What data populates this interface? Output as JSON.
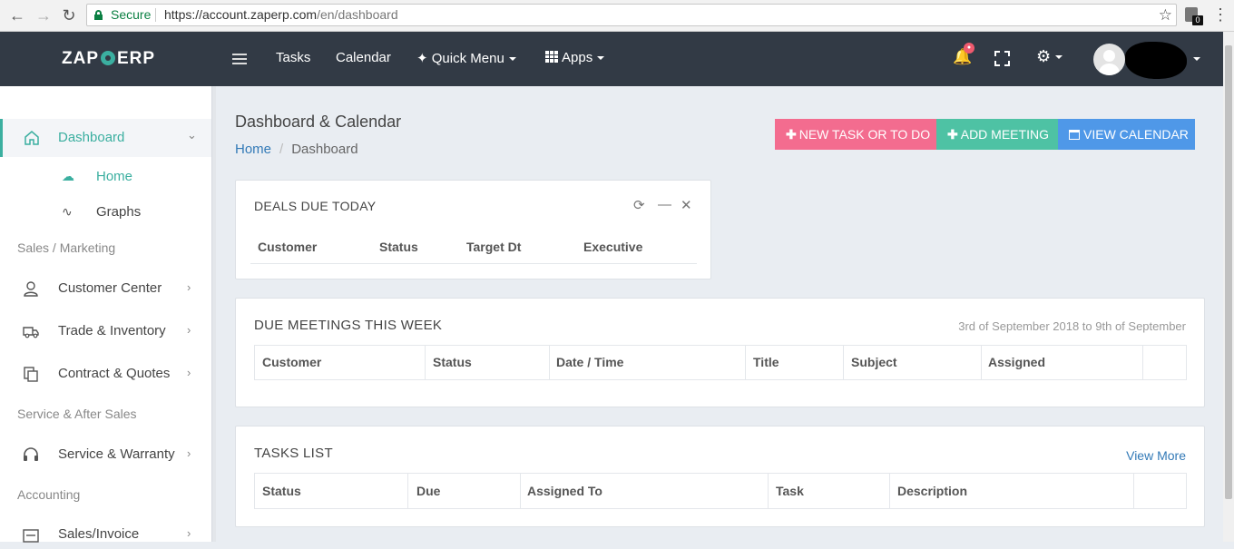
{
  "browser": {
    "secure_label": "Secure",
    "url_host": "https://account.zaperp.com",
    "url_path": "/en/dashboard",
    "ext_badge": "0"
  },
  "topnav": {
    "logo_left": "ZAP",
    "logo_right": "ERP",
    "links": [
      "Tasks",
      "Calendar",
      "Quick Menu",
      "Apps"
    ],
    "accent_color": "#3bafa0"
  },
  "sidebar": {
    "dashboard": "Dashboard",
    "home": "Home",
    "graphs": "Graphs",
    "section_sales": "Sales / Marketing",
    "customer_center": "Customer Center",
    "trade_inventory": "Trade & Inventory",
    "contract_quotes": "Contract & Quotes",
    "section_service": "Service & After Sales",
    "service_warranty": "Service & Warranty",
    "section_accounting": "Accounting",
    "sales_invoice": "Sales/Invoice"
  },
  "main": {
    "title": "Dashboard & Calendar",
    "breadcrumb": [
      "Home",
      "Dashboard"
    ],
    "buttons": {
      "new_task": "NEW TASK OR TO DO",
      "add_meeting": "ADD MEETING",
      "view_calendar": "VIEW CALENDAR"
    }
  },
  "deals_panel": {
    "title": "DEALS DUE TODAY",
    "columns": [
      "Customer",
      "Status",
      "Target Dt",
      "Executive"
    ]
  },
  "meetings_panel": {
    "title": "DUE MEETINGS THIS WEEK",
    "range": "3rd of September 2018 to 9th of September",
    "columns": [
      "Customer",
      "Status",
      "Date / Time",
      "Title",
      "Subject",
      "Assigned"
    ]
  },
  "tasks_panel": {
    "title": "TASKS LIST",
    "view_more": "View More",
    "columns": [
      "Status",
      "Due",
      "Assigned To",
      "Task",
      "Description"
    ]
  }
}
